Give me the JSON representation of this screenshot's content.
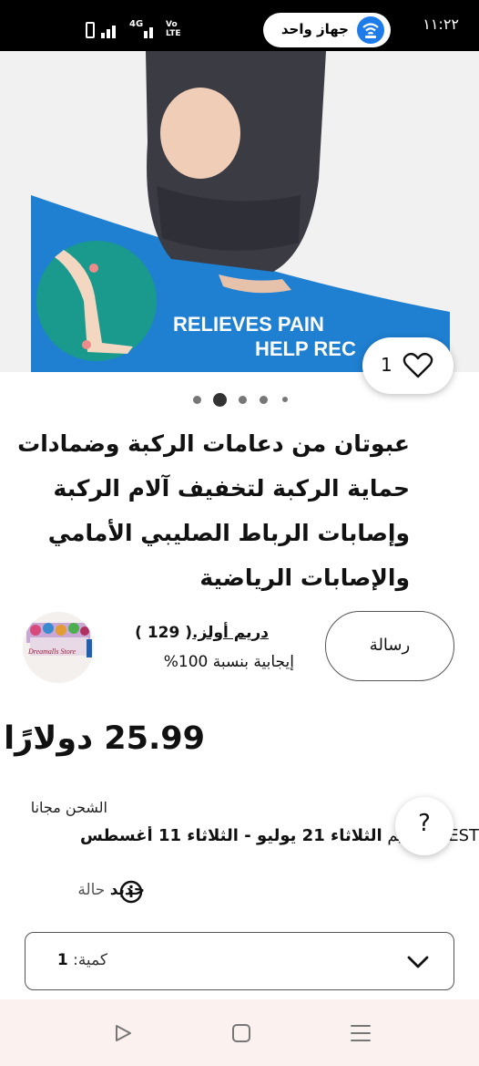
{
  "status_bar": {
    "time": "١١:٢٢",
    "device_label": "جهاز واحد",
    "network": "4G",
    "volte": "Vo LTE"
  },
  "hero": {
    "banner_line1": "RELIEVES PAIN",
    "banner_line2": "HELP REC",
    "like_count": "1",
    "image_count": 5,
    "current_image_index": 1
  },
  "product": {
    "title": "عبوتان من دعامات الركبة وضمادات حماية الركبة لتخفيف آلام الركبة وإصابات الرباط الصليبي الأمامي والإصابات الرياضية"
  },
  "seller": {
    "name": "دريم أولز.",
    "feedback_count": "( 129 )",
    "positive": "إيجابية بنسبة 100%",
    "avatar_text": "Dreamalls Store",
    "message_label": "رسالة"
  },
  "price": "25.99 دولارًا",
  "shipping": {
    "free": "الشحن مجانا",
    "estimate_prefix": "EST. التسليم",
    "estimate_range": "الثلاثاء 21 يوليو - الثلاثاء 11 أغسطس"
  },
  "help_label": "?",
  "condition": {
    "label": "حالة",
    "value": "جديد"
  },
  "quantity": {
    "label": "كمية:",
    "value": "1"
  },
  "colors": {
    "banner_blue": "#1f7fd1",
    "banner_teal": "#1a9a8c",
    "accent_blue": "#1e7bea"
  }
}
